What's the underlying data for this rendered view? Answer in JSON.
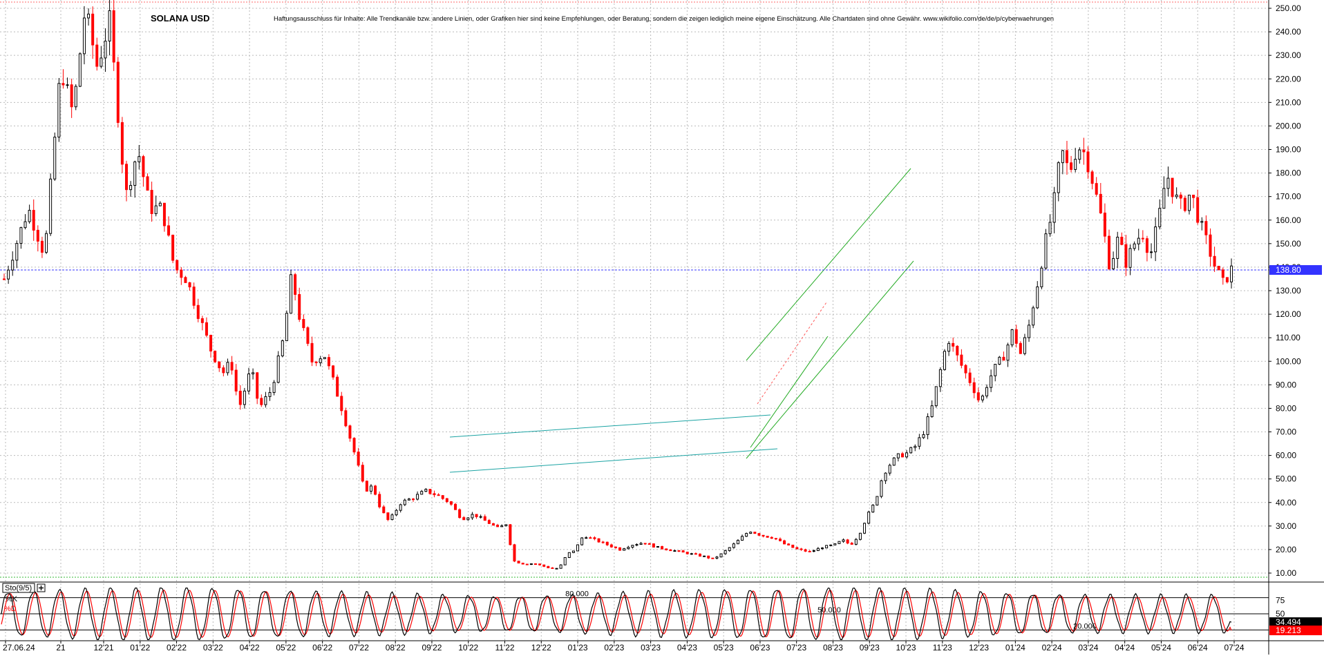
{
  "header": {
    "title": "SOLANA USD",
    "disclaimer": "Haftungsausschluss für Inhalte: Alle Trendkanäle bzw. andere Linien, oder Grafiken hier sind keine Empfehlungen, oder Beratung, sondern die zeigen lediglich meine eigene Einschätzung. Alle Chartdaten sind ohne Gewähr.  www.wikifolio.com/de/de/p/cyberwaehrungen"
  },
  "colors": {
    "up_candle": "#000000",
    "down_candle": "#ff0000",
    "channel_green": "#22aa22",
    "channel_teal": "#1aa3a3",
    "dotted_line": "#ff5555",
    "price_line": "#3333ff",
    "price_tag": "#3333ff",
    "k_line": "#000000",
    "d_line": "#ff0000",
    "k_tag": "#000000",
    "d_tag": "#ff0000",
    "grid": "#b9b9b9"
  },
  "chart_data": [
    {
      "type": "candlestick",
      "title": "SOLANA USD",
      "ylim": [
        7,
        252
      ],
      "y_ticks": [
        "10.00",
        "20.00",
        "30.00",
        "40.00",
        "50.00",
        "60.00",
        "70.00",
        "80.00",
        "90.00",
        "100.00",
        "110.00",
        "120.00",
        "130.00",
        "140.00",
        "150.00",
        "160.00",
        "170.00",
        "180.00",
        "190.00",
        "200.00",
        "210.00",
        "220.00",
        "230.00",
        "240.00",
        "250.00"
      ],
      "x_ticks": [
        "27.06.24",
        "21",
        "12'21",
        "01'22",
        "02'22",
        "03'22",
        "04'22",
        "05'22",
        "06'22",
        "07'22",
        "08'22",
        "09'22",
        "10'22",
        "11'22",
        "12'22",
        "01'23",
        "02'23",
        "03'23",
        "04'23",
        "05'23",
        "06'23",
        "07'23",
        "08'23",
        "09'23",
        "10'23",
        "11'23",
        "12'23",
        "01'24",
        "02'24",
        "03'24",
        "04'24",
        "05'24",
        "06'24",
        "07'24"
      ],
      "last_price": 138.8,
      "last_price_label": "138.80",
      "path": [
        [
          0,
          135
        ],
        [
          6,
          165
        ],
        [
          10,
          145
        ],
        [
          14,
          225
        ],
        [
          17,
          205
        ],
        [
          20,
          250
        ],
        [
          23,
          225
        ],
        [
          26,
          245
        ],
        [
          30,
          170
        ],
        [
          33,
          190
        ],
        [
          36,
          165
        ],
        [
          39,
          165
        ],
        [
          42,
          140
        ],
        [
          45,
          135
        ],
        [
          48,
          120
        ],
        [
          51,
          105
        ],
        [
          54,
          95
        ],
        [
          56,
          100
        ],
        [
          58,
          80
        ],
        [
          61,
          97
        ],
        [
          63,
          80
        ],
        [
          66,
          88
        ],
        [
          69,
          110
        ],
        [
          71,
          137
        ],
        [
          73,
          118
        ],
        [
          76,
          100
        ],
        [
          79,
          103
        ],
        [
          81,
          93
        ],
        [
          83,
          82
        ],
        [
          85,
          70
        ],
        [
          87,
          58
        ],
        [
          89,
          45
        ],
        [
          91,
          47
        ],
        [
          93,
          37
        ],
        [
          95,
          32
        ],
        [
          98,
          40
        ],
        [
          101,
          42
        ],
        [
          104,
          45
        ],
        [
          107,
          43
        ],
        [
          110,
          40
        ],
        [
          113,
          33
        ],
        [
          116,
          35
        ],
        [
          119,
          32
        ],
        [
          122,
          29
        ],
        [
          124,
          31
        ],
        [
          125,
          22
        ],
        [
          126,
          15
        ],
        [
          128,
          14
        ],
        [
          131,
          14
        ],
        [
          133,
          13
        ],
        [
          135,
          12
        ],
        [
          137,
          12
        ],
        [
          139,
          18
        ],
        [
          141,
          20
        ],
        [
          143,
          26
        ],
        [
          146,
          24
        ],
        [
          149,
          22
        ],
        [
          152,
          20
        ],
        [
          155,
          22
        ],
        [
          158,
          23
        ],
        [
          161,
          21
        ],
        [
          164,
          20
        ],
        [
          167,
          19
        ],
        [
          170,
          18
        ],
        [
          173,
          17
        ],
        [
          175,
          16
        ],
        [
          177,
          18
        ],
        [
          180,
          22
        ],
        [
          182,
          25
        ],
        [
          184,
          28
        ],
        [
          187,
          26
        ],
        [
          190,
          25
        ],
        [
          193,
          22
        ],
        [
          196,
          20
        ],
        [
          199,
          19
        ],
        [
          202,
          21
        ],
        [
          205,
          22
        ],
        [
          207,
          24
        ],
        [
          209,
          22
        ],
        [
          211,
          26
        ],
        [
          213,
          34
        ],
        [
          215,
          40
        ],
        [
          217,
          52
        ],
        [
          219,
          57
        ],
        [
          221,
          60
        ],
        [
          223,
          61
        ],
        [
          225,
          64
        ],
        [
          227,
          70
        ],
        [
          229,
          80
        ],
        [
          231,
          95
        ],
        [
          233,
          110
        ],
        [
          235,
          103
        ],
        [
          237,
          96
        ],
        [
          239,
          90
        ],
        [
          241,
          82
        ],
        [
          243,
          92
        ],
        [
          245,
          98
        ],
        [
          247,
          103
        ],
        [
          249,
          113
        ],
        [
          251,
          103
        ],
        [
          253,
          115
        ],
        [
          255,
          132
        ],
        [
          257,
          150
        ],
        [
          259,
          165
        ],
        [
          261,
          190
        ],
        [
          263,
          180
        ],
        [
          265,
          192
        ],
        [
          267,
          188
        ],
        [
          269,
          175
        ],
        [
          271,
          160
        ],
        [
          273,
          140
        ],
        [
          275,
          152
        ],
        [
          277,
          142
        ],
        [
          279,
          150
        ],
        [
          281,
          155
        ],
        [
          283,
          145
        ],
        [
          285,
          160
        ],
        [
          287,
          180
        ],
        [
          289,
          170
        ],
        [
          291,
          165
        ],
        [
          293,
          172
        ],
        [
          295,
          160
        ],
        [
          297,
          150
        ],
        [
          299,
          140
        ],
        [
          301,
          133
        ],
        [
          303,
          139
        ]
      ],
      "overlays": [
        {
          "kind": "trendline",
          "color": "green",
          "points": [
            [
              1080,
              522
            ],
            [
              1318,
              244
            ]
          ]
        },
        {
          "kind": "trendline",
          "color": "green",
          "points": [
            [
              1080,
              664
            ],
            [
              1322,
              378
            ]
          ]
        },
        {
          "kind": "trendline",
          "color": "green",
          "points": [
            [
              1086,
              648
            ],
            [
              1198,
              487
            ]
          ]
        },
        {
          "kind": "trendline",
          "color": "teal",
          "points": [
            [
              651,
              633
            ],
            [
              1115,
              601
            ]
          ]
        },
        {
          "kind": "trendline",
          "color": "teal",
          "points": [
            [
              651,
              684
            ],
            [
              1125,
              650
            ]
          ]
        },
        {
          "kind": "dotted",
          "color": "red",
          "points": [
            [
              1096,
              585
            ],
            [
              1196,
              438
            ]
          ]
        }
      ]
    },
    {
      "type": "line",
      "title": "Sto(9/5)",
      "ylim": [
        0,
        100
      ],
      "series": [
        {
          "name": "%K",
          "last": 34.494,
          "last_label": "34.494"
        },
        {
          "name": "%D",
          "last": 19.213,
          "last_label": "19.213"
        }
      ],
      "levels": [
        {
          "value": 80,
          "label": "80.000"
        },
        {
          "value": 50,
          "label": "50.000"
        },
        {
          "value": 20,
          "label": "20.000"
        }
      ],
      "axis_labels": [
        "75",
        "50",
        "25"
      ],
      "cycles": 48
    }
  ]
}
